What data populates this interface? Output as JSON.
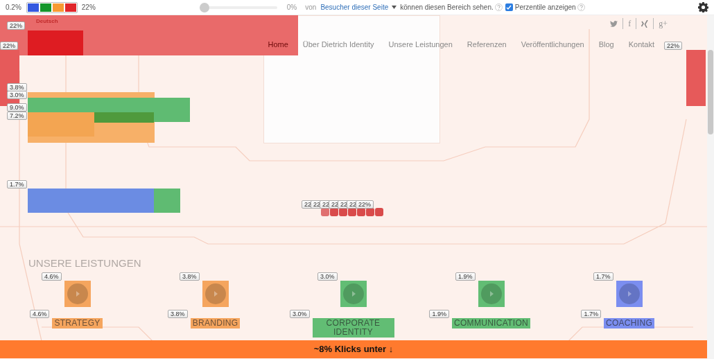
{
  "toolbar": {
    "min_label": "0.2%",
    "legend": [
      {
        "color": "#3458e0"
      },
      {
        "color": "#15962b"
      },
      {
        "color": "#f79a32"
      },
      {
        "color": "#e0262a"
      }
    ],
    "max_label": "22%",
    "slider": {
      "level": 0,
      "reading": "0%"
    },
    "von": "von",
    "audience": "Besucher dieser Seite",
    "suffix": "können diesen Bereich sehen.",
    "percentiles": {
      "label": "Perzentile anzeigen",
      "checked": true
    }
  },
  "site": {
    "language": "Deutsch",
    "social": [
      {
        "kind": "bird"
      },
      {
        "kind": "glyph",
        "text": "f"
      },
      {
        "kind": "xing"
      },
      {
        "kind": "glyph",
        "text": "g+"
      }
    ],
    "nav": [
      {
        "label": "Home",
        "selected": true
      },
      {
        "label": "Über Dietrich Identity",
        "selected": false
      },
      {
        "label": "Unsere Leistungen",
        "selected": false
      },
      {
        "label": "Referenzen",
        "selected": false
      },
      {
        "label": "Veröffentlichungen",
        "selected": false
      },
      {
        "label": "Blog",
        "selected": false
      },
      {
        "label": "Kontakt",
        "selected": false
      }
    ],
    "section_title": "UNSERE LEISTUNGEN",
    "services": [
      {
        "name": "STRATEGY",
        "icon_clicks": "4.6%",
        "label_clicks": "4.6%",
        "color": "#f5a55e"
      },
      {
        "name": "BRANDING",
        "icon_clicks": "3.8%",
        "label_clicks": "3.8%",
        "color": "#f5a55e"
      },
      {
        "name": "CORPORATE IDENTITY",
        "icon_clicks": "3.0%",
        "label_clicks": "3.0%",
        "color": "#62bd74"
      },
      {
        "name": "COMMUNICATION",
        "icon_clicks": "1.9%",
        "label_clicks": "1.9%",
        "color": "#62bd74"
      },
      {
        "name": "COACHING",
        "icon_clicks": "1.7%",
        "label_clicks": "1.7%",
        "color": "#7b8ef0"
      }
    ]
  },
  "overlays": [
    {
      "color": "#e96a6a"
    },
    {
      "label": "22%",
      "color": "#de1c22"
    },
    {
      "label": "22%",
      "color": "#e65a5a"
    },
    {
      "label": "3.8%",
      "color": "#f7b068"
    },
    {
      "label": "3.0%",
      "color": "#5fbb72"
    },
    {
      "label": "9.0%",
      "color": "#4f9a3c"
    },
    {
      "label": "7.2%",
      "color": "#f3a552"
    },
    {
      "label": "1.7%",
      "color": "#6b8ce3"
    },
    {
      "color": "#5fbb72"
    },
    {
      "label": "22",
      "color": "#e07070"
    },
    {
      "label": "22",
      "color": "#d94b4b"
    },
    {
      "label": "22",
      "color": "#d94b4b"
    },
    {
      "label": "22",
      "color": "#d94b4b"
    },
    {
      "label": "22",
      "color": "#d94b4b"
    },
    {
      "label": "22",
      "color": "#d94b4b"
    },
    {
      "label": "22%",
      "color": "#d94b4b"
    },
    {
      "label": "22%",
      "color": "#e65a5a"
    }
  ],
  "scroll_notice": "~8% Klicks unter ↓"
}
